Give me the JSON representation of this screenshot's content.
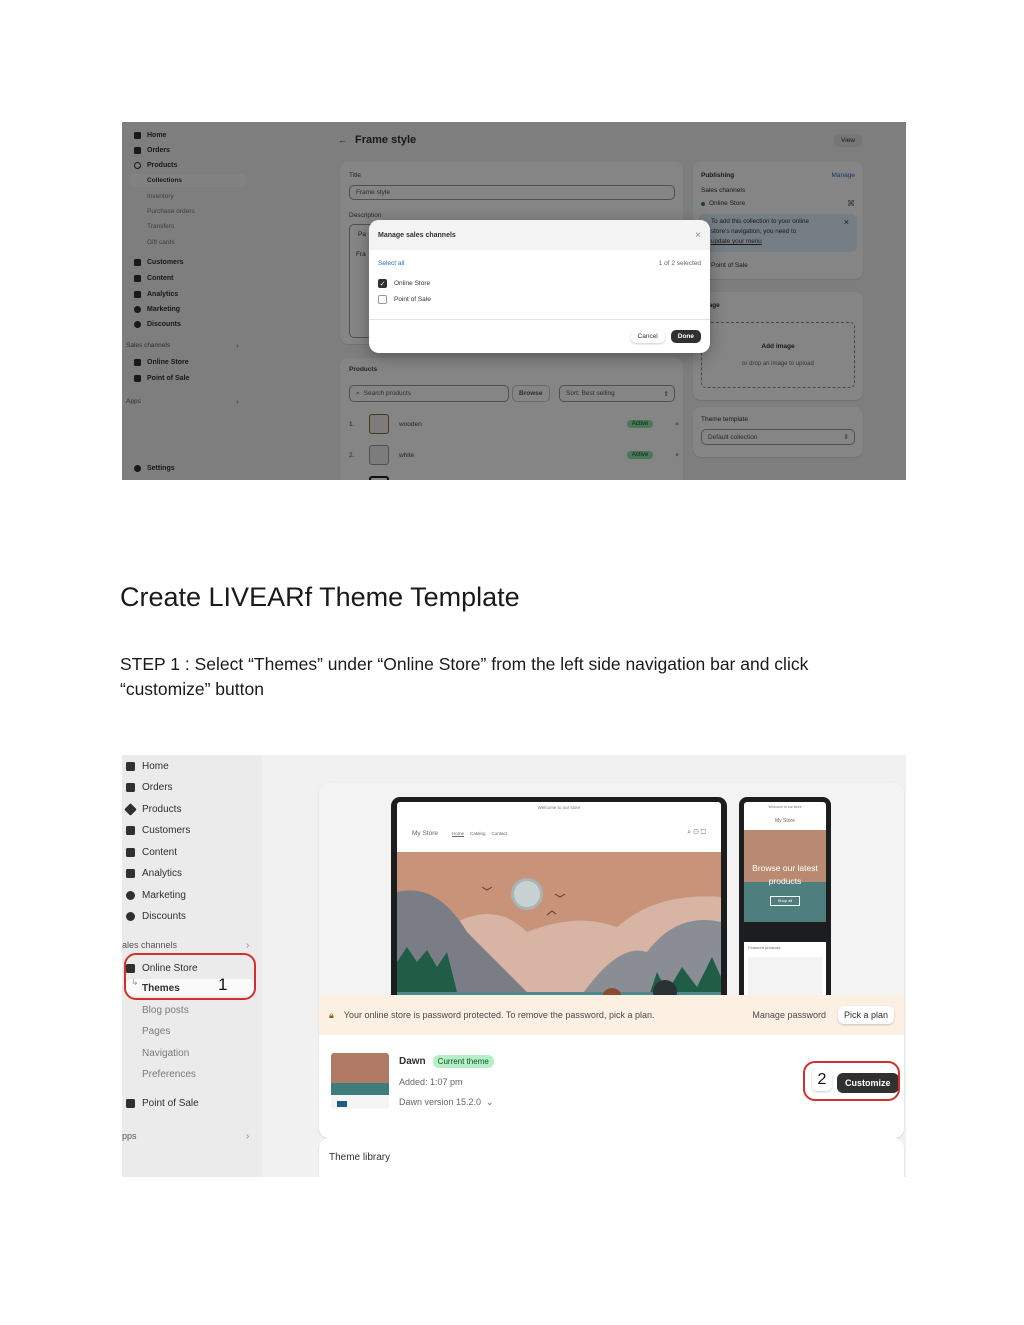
{
  "screenshot1": {
    "sidebar": {
      "items": [
        {
          "label": "Home",
          "icon": "home-icon"
        },
        {
          "label": "Orders",
          "icon": "orders-icon"
        },
        {
          "label": "Products",
          "icon": "tag-icon"
        }
      ],
      "product_subitems": [
        "Collections",
        "Inventory",
        "Purchase orders",
        "Transfers",
        "Gift cards"
      ],
      "items2": [
        {
          "label": "Customers",
          "icon": "person-icon"
        },
        {
          "label": "Content",
          "icon": "content-icon"
        },
        {
          "label": "Analytics",
          "icon": "bar-chart-icon"
        },
        {
          "label": "Marketing",
          "icon": "target-icon"
        },
        {
          "label": "Discounts",
          "icon": "discount-icon"
        }
      ],
      "sales_channels_label": "Sales channels",
      "channels": [
        {
          "label": "Online Store",
          "icon": "store-icon"
        },
        {
          "label": "Point of Sale",
          "icon": "pos-icon"
        }
      ],
      "apps_label": "Apps",
      "settings_label": "Settings",
      "chevron": "›"
    },
    "page": {
      "back_arrow": "←",
      "title": "Frame style",
      "view_button": "View",
      "title_label": "Title",
      "title_value": "Frame style",
      "description_label": "Description",
      "description_partial_1": "Pa",
      "description_partial_2": "Fra"
    },
    "products": {
      "heading": "Products",
      "search_placeholder": "Search products",
      "browse_button": "Browse",
      "sort_value": "Sort: Best selling",
      "rows": [
        {
          "index": "1.",
          "name": "wooden",
          "status": "Active"
        },
        {
          "index": "2.",
          "name": "white",
          "status": "Active"
        }
      ],
      "remove_glyph": "×"
    },
    "publishing": {
      "heading": "Publishing",
      "manage_link": "Manage",
      "sales_channels_label": "Sales channels",
      "online_store": "Online Store",
      "notice_line1": "To add this collection to your online",
      "notice_line2": "store's navigation, you need to",
      "notice_link": "update your menu",
      "point_of_sale": "Point of Sale"
    },
    "image_card": {
      "heading": "Image",
      "add_button": "Add image",
      "hint": "or drop an image to upload"
    },
    "theme_template": {
      "label": "Theme template",
      "value": "Default collection"
    },
    "modal": {
      "title": "Manage sales channels",
      "close_glyph": "×",
      "select_all": "Select all",
      "selected_count": "1 of 2 selected",
      "options": [
        {
          "label": "Online Store",
          "checked": true
        },
        {
          "label": "Point of Sale",
          "checked": false
        }
      ],
      "cancel": "Cancel",
      "done": "Done"
    }
  },
  "document": {
    "heading": "Create LIVEARf Theme Template",
    "step1": "STEP 1 : Select “Themes” under “Online Store” from the left side navigation bar and click “customize” button"
  },
  "screenshot2": {
    "sidebar": {
      "items": [
        {
          "label": "Home",
          "icon": "home-icon"
        },
        {
          "label": "Orders",
          "icon": "orders-icon"
        },
        {
          "label": "Products",
          "icon": "tag-icon"
        },
        {
          "label": "Customers",
          "icon": "person-icon"
        },
        {
          "label": "Content",
          "icon": "content-icon"
        },
        {
          "label": "Analytics",
          "icon": "bar-chart-icon"
        },
        {
          "label": "Marketing",
          "icon": "target-icon"
        },
        {
          "label": "Discounts",
          "icon": "discount-icon"
        }
      ],
      "sales_channels_label": "ales channels",
      "online_store": "Online Store",
      "themes": "Themes",
      "online_store_subitems": [
        "Blog posts",
        "Pages",
        "Navigation",
        "Preferences"
      ],
      "point_of_sale": "Point of Sale",
      "apps_label": "pps",
      "chevron": "›"
    },
    "annotations": {
      "marker1": "1",
      "marker2": "2",
      "ring_color": "#d0312d"
    },
    "preview": {
      "announcement": "Welcome to our store",
      "store_name": "My Store",
      "nav_links": [
        "Home",
        "Catalog",
        "Contact"
      ],
      "phone_hero_text": "Browse our latest products",
      "phone_button": "Shop all",
      "phone_featured": "Featured products"
    },
    "password_banner": {
      "message": "Your online store is password protected. To remove the password, pick a plan.",
      "manage_password": "Manage password",
      "pick_plan": "Pick a plan"
    },
    "current_theme": {
      "name": "Dawn",
      "badge": "Current theme",
      "added": "Added: 1:07 pm",
      "version": "Dawn version 15.2.0",
      "version_chevron": "⌄",
      "customize_button": "Customize"
    },
    "theme_library": {
      "heading": "Theme library"
    }
  }
}
